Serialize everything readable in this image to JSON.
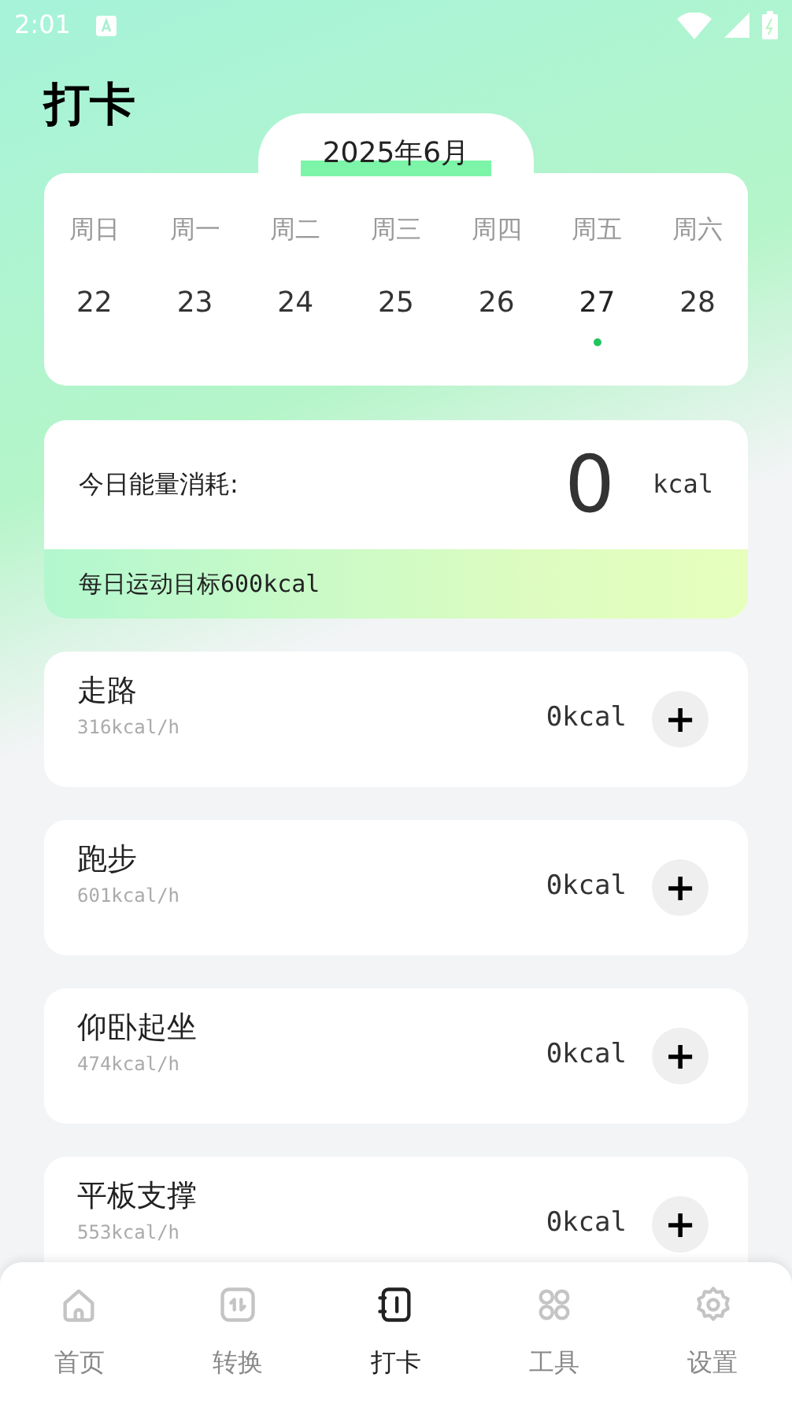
{
  "status_bar": {
    "time": "2:01"
  },
  "title": "打卡",
  "calendar": {
    "month": "2025年6月",
    "weekdays": [
      "周日",
      "周一",
      "周二",
      "周三",
      "周四",
      "周五",
      "周六"
    ],
    "days": [
      {
        "label": "22",
        "selected": false
      },
      {
        "label": "23",
        "selected": false
      },
      {
        "label": "24",
        "selected": false
      },
      {
        "label": "25",
        "selected": false
      },
      {
        "label": "26",
        "selected": false
      },
      {
        "label": "27",
        "selected": true
      },
      {
        "label": "28",
        "selected": false
      }
    ]
  },
  "energy": {
    "label": "今日能量消耗:",
    "value": "0",
    "unit": "kcal",
    "goal": "每日运动目标600kcal"
  },
  "activities": [
    {
      "name": "走路",
      "rate": "316kcal/h",
      "amount": "0kcal",
      "button": "+"
    },
    {
      "name": "跑步",
      "rate": "601kcal/h",
      "amount": "0kcal",
      "button": "+"
    },
    {
      "name": "仰卧起坐",
      "rate": "474kcal/h",
      "amount": "0kcal",
      "button": "+"
    },
    {
      "name": "平板支撑",
      "rate": "553kcal/h",
      "amount": "0kcal",
      "button": "+"
    }
  ],
  "nav": [
    {
      "label": "首页",
      "kind": "home",
      "selected": false
    },
    {
      "label": "转换",
      "kind": "convert",
      "selected": false
    },
    {
      "label": "打卡",
      "kind": "checkin",
      "selected": true
    },
    {
      "label": "工具",
      "kind": "tools",
      "selected": false
    },
    {
      "label": "设置",
      "kind": "settings",
      "selected": false
    }
  ]
}
